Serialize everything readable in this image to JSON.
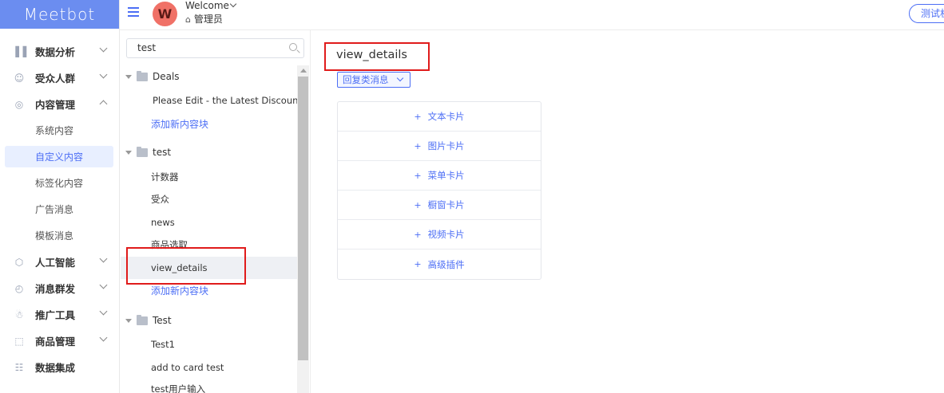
{
  "app": {
    "logo": "Meetbot"
  },
  "header": {
    "avatar_letter": "W",
    "welcome": "Welcome",
    "role": "管理员",
    "test_button": "测试机"
  },
  "sidebar": {
    "items": [
      {
        "label": "数据分析",
        "icon": "chart-icon"
      },
      {
        "label": "受众人群",
        "icon": "users-icon"
      },
      {
        "label": "内容管理",
        "icon": "content-icon",
        "expanded": true,
        "children": [
          "系统内容",
          "自定义内容",
          "标签化内容",
          "广告消息",
          "模板消息"
        ],
        "active_child": "自定义内容"
      },
      {
        "label": "人工智能",
        "icon": "ai-icon"
      },
      {
        "label": "消息群发",
        "icon": "clock-icon"
      },
      {
        "label": "推广工具",
        "icon": "promo-icon"
      },
      {
        "label": "商品管理",
        "icon": "box-icon"
      },
      {
        "label": "数据集成",
        "icon": "grid-icon"
      }
    ]
  },
  "tree": {
    "search_value": "test",
    "folders": [
      {
        "name": "Deals",
        "items": [
          "Please Edit - the Latest Discounts"
        ],
        "add_label": "添加新内容块"
      },
      {
        "name": "test",
        "items": [
          "计数器",
          "受众",
          "news",
          "商品选取",
          "view_details"
        ],
        "selected": "view_details",
        "add_label": "添加新内容块"
      },
      {
        "name": "Test",
        "items": [
          "Test1",
          "add to card test",
          "test用户输入"
        ]
      }
    ]
  },
  "main": {
    "title": "view_details",
    "reply_button": "回复类消息",
    "cards": [
      "文本卡片",
      "图片卡片",
      "菜单卡片",
      "橱窗卡片",
      "视频卡片",
      "高级插件"
    ],
    "plus": "+"
  },
  "colors": {
    "accent": "#4c6ef5",
    "highlight_box": "#e01b1b",
    "avatar": "#f07167"
  }
}
